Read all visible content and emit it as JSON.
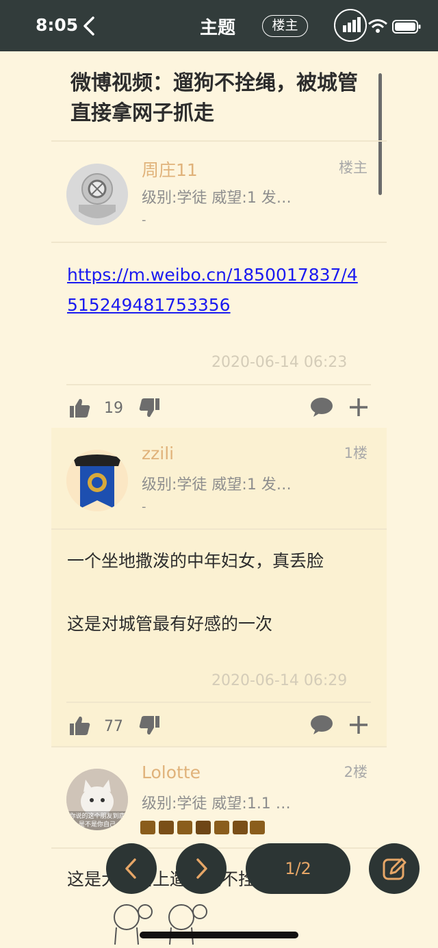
{
  "status": {
    "time": "8:05"
  },
  "nav": {
    "title": "主题",
    "owner_filter": "楼主"
  },
  "topic": {
    "title": "微博视频：遛狗不拴绳，被城管直接拿网子抓走"
  },
  "posts": [
    {
      "username": "周庄11",
      "floor": "楼主",
      "meta": "级别:学徒  威望:1  发…",
      "dash": "-",
      "link": "https://m.weibo.cn/1850017837/4515249481753356",
      "datetime": "2020-06-14 06:23",
      "likes": "19"
    },
    {
      "username": "zzili",
      "floor": "1楼",
      "meta": "级别:学徒  威望:1  发…",
      "dash": "-",
      "lines": [
        "一个坐地撒泼的中年妇女，真丢脸",
        "这是对城管最有好感的一次"
      ],
      "datetime": "2020-06-14 06:29",
      "likes": "77"
    },
    {
      "username": "Lolotte",
      "floor": "2楼",
      "meta": "级别:学徒  威望:1.1  …",
      "lines": [
        "这是大马路上遛狗还不拴绳子吗。。。"
      ],
      "avatar_caption": "你说的这个朋友到底是不是你自己"
    }
  ],
  "pager": {
    "label": "1/2"
  },
  "colors": {
    "accent": "#e0b27a",
    "bar": "#323c3b",
    "background": "#fdf5de"
  }
}
